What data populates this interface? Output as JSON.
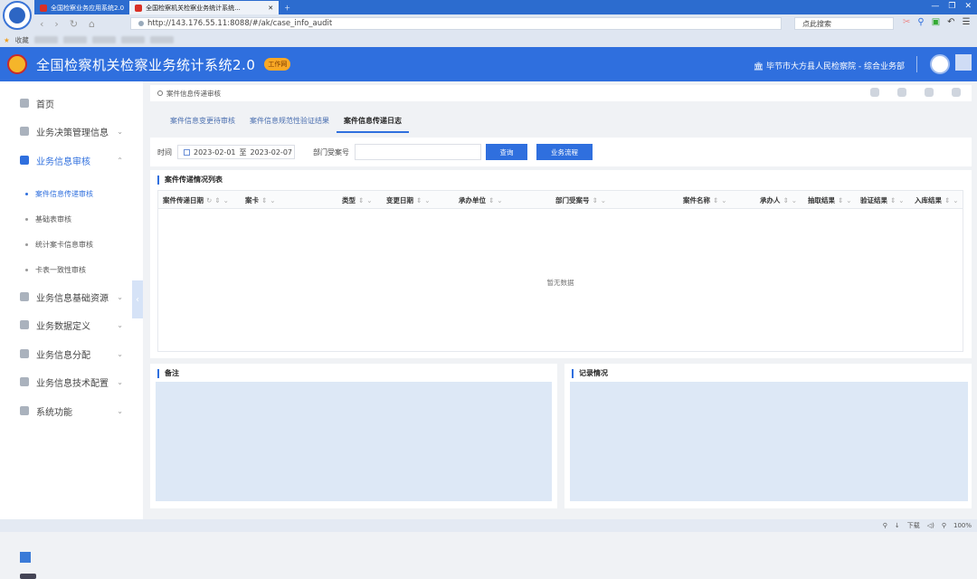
{
  "browser": {
    "tabs": [
      {
        "label": "全国检察业务应用系统2.0"
      },
      {
        "label": "全国检察机关检察业务统计系统..."
      }
    ],
    "url": "http://143.176.55.11:8088/#/ak/case_info_audit",
    "search_placeholder": "点此搜索",
    "fav_label": "收藏",
    "status": {
      "download": "下载",
      "zoom": "100%"
    }
  },
  "header": {
    "title": "全国检察机关检察业务统计系统2.0",
    "badge": "工作网",
    "unit": "毕节市大方县人民检察院 - 综合业务部"
  },
  "sidebar": {
    "items": [
      {
        "label": "首页",
        "icon": "home-icon"
      },
      {
        "label": "业务决策管理信息",
        "icon": "doc-icon"
      },
      {
        "label": "业务信息审核",
        "icon": "user-icon"
      },
      {
        "label": "业务信息基础资源",
        "icon": "cube-icon"
      },
      {
        "label": "业务数据定义",
        "icon": "chart-icon"
      },
      {
        "label": "业务信息分配",
        "icon": "share-icon"
      },
      {
        "label": "业务信息技术配置",
        "icon": "keyboard-icon"
      },
      {
        "label": "系统功能",
        "icon": "system-icon"
      }
    ],
    "sub": [
      {
        "label": "案件信息传递审核"
      },
      {
        "label": "基础表审核"
      },
      {
        "label": "统计案卡信息审核"
      },
      {
        "label": "卡表一致性审核"
      }
    ]
  },
  "breadcrumb": "案件信息传递审核",
  "tabs": [
    {
      "label": "案件信息变更待审核"
    },
    {
      "label": "案件信息规范性验证结果"
    },
    {
      "label": "案件信息传递日志"
    }
  ],
  "filter": {
    "time_label": "时间",
    "start": "2023-02-01",
    "to": "至",
    "end": "2023-02-07",
    "dept_label": "部门受案号",
    "query_btn": "查询",
    "flow_btn": "业务流程"
  },
  "table": {
    "title": "案件传递情况列表",
    "columns": [
      "案件传递日期",
      "案卡",
      "类型",
      "变更日期",
      "承办单位",
      "部门受案号",
      "案件名称",
      "承办人",
      "抽取结果",
      "验证结果",
      "入库结果"
    ],
    "empty": "暂无数据"
  },
  "notes": {
    "left_title": "备注",
    "right_title": "记录情况"
  },
  "colors": {
    "primary": "#2f6fde",
    "note_bg": "#dde8f6"
  }
}
